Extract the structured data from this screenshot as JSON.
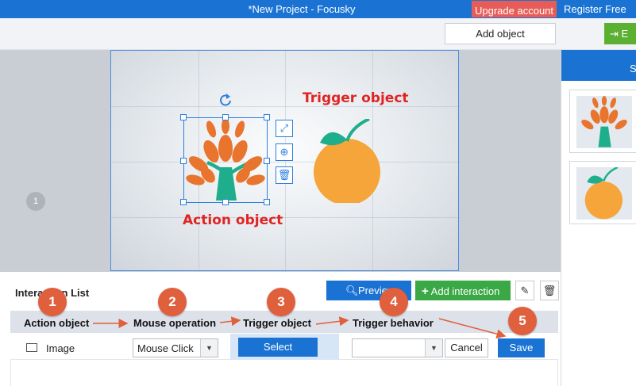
{
  "titlebar": {
    "title": "*New Project - Focusky",
    "upgrade_label": "Upgrade account",
    "register_label": "Register Free"
  },
  "toolbar": {
    "add_object_label": "Add object",
    "exit_label": "E"
  },
  "workspace": {
    "page_number": "1"
  },
  "canvas": {
    "trigger_label": "Trigger object",
    "action_label": "Action object",
    "icons": {
      "rotate": "rotate-icon",
      "resize": "resize-icon",
      "zoom": "zoom-in-icon",
      "delete": "trash-icon"
    },
    "colors": {
      "leaf": "#e8742e",
      "trunk": "#1fae8c",
      "orange": "#f5a53a",
      "selection": "#2d7fe0"
    }
  },
  "right_panel": {
    "header_label": "S"
  },
  "interaction": {
    "list_title": "Interaction List",
    "preview_label": "Preview",
    "add_interaction_label": "Add interaction",
    "columns": {
      "action": "Action object",
      "mouse": "Mouse operation",
      "trigger": "Trigger object",
      "behavior": "Trigger behavior"
    },
    "row": {
      "object_name": "Image",
      "mouse_value": "Mouse Click",
      "select_label": "Select",
      "behavior_value": "",
      "cancel_label": "Cancel",
      "save_label": "Save"
    }
  },
  "steps": [
    "1",
    "2",
    "3",
    "4",
    "5"
  ],
  "colors": {
    "brand": "#1a73d3",
    "upgrade": "#e85c57",
    "green": "#3aa845",
    "step": "#e05f3c",
    "label_red": "#e02424"
  }
}
